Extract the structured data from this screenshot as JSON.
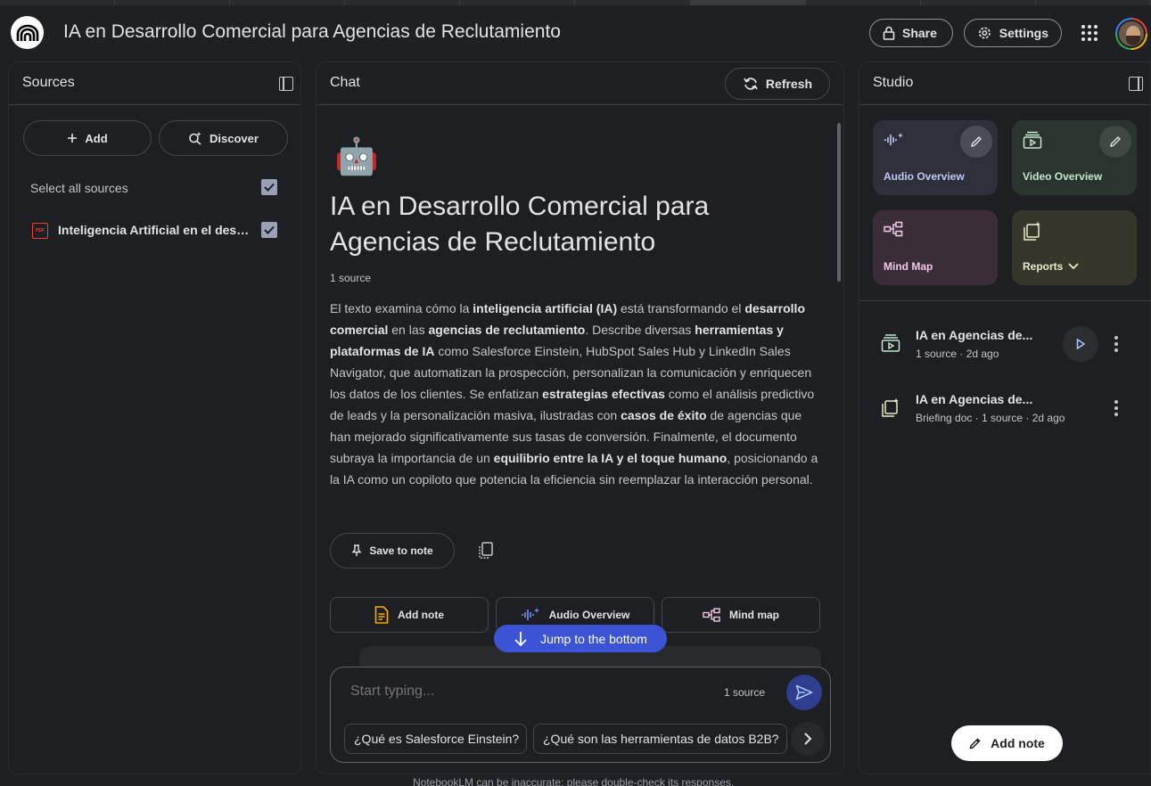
{
  "header": {
    "app_title": "IA en Desarrollo Comercial para Agencias de Reclutamiento",
    "share_label": "Share",
    "settings_label": "Settings"
  },
  "sources": {
    "title": "Sources",
    "add_label": "Add",
    "discover_label": "Discover",
    "select_all_label": "Select all sources",
    "items": [
      {
        "name": "Inteligencia Artificial en el desarrollo comercial de agencias de reclutamiento",
        "checked": true
      }
    ]
  },
  "chat": {
    "title": "Chat",
    "refresh_label": "Refresh",
    "emoji": "🤖",
    "doc_title": "IA en Desarrollo Comercial para Agencias de Reclutamiento",
    "source_count": "1 source",
    "summary_segments": [
      {
        "text": "El texto examina cómo la ",
        "bold": false
      },
      {
        "text": "inteligencia artificial (IA)",
        "bold": true
      },
      {
        "text": " está transformando el ",
        "bold": false
      },
      {
        "text": "desarrollo comercial",
        "bold": true
      },
      {
        "text": " en las ",
        "bold": false
      },
      {
        "text": "agencias de reclutamiento",
        "bold": true
      },
      {
        "text": ". Describe diversas ",
        "bold": false
      },
      {
        "text": "herramientas y plataformas de IA",
        "bold": true
      },
      {
        "text": " como Salesforce Einstein, HubSpot Sales Hub y LinkedIn Sales Navigator, que automatizan la prospección, personalizan la comunicación y enriquecen los datos de los clientes. Se enfatizan ",
        "bold": false
      },
      {
        "text": "estrategias efectivas",
        "bold": true
      },
      {
        "text": " como el análisis predictivo de leads y la personalización masiva, ilustradas con ",
        "bold": false
      },
      {
        "text": "casos de éxito",
        "bold": true
      },
      {
        "text": " de agencias que han mejorado significativamente sus tasas de conversión. Finalmente, el documento subraya la importancia de un ",
        "bold": false
      },
      {
        "text": "equilibrio entre la IA y el toque humano",
        "bold": true
      },
      {
        "text": ", posicionando a la IA como un copiloto que potencia la eficiencia sin reemplazar la interacción personal.",
        "bold": false
      }
    ],
    "save_to_note_label": "Save to note",
    "actions": {
      "add_note": "Add note",
      "audio_overview": "Audio Overview",
      "mind_map": "Mind map"
    },
    "jump_label": "Jump to the bottom",
    "composer": {
      "placeholder": "Start typing...",
      "source_count": "1 source"
    },
    "suggestions": [
      "¿Qué es Salesforce Einstein?",
      "¿Qué son las herramientas de datos B2B?"
    ]
  },
  "studio": {
    "title": "Studio",
    "tiles": {
      "audio": "Audio Overview",
      "video": "Video Overview",
      "mind": "Mind Map",
      "reports": "Reports"
    },
    "notes": [
      {
        "title": "IA en Agencias de...",
        "meta": "1 source · 2d ago"
      },
      {
        "title": "IA en Agencias de...",
        "meta": "Briefing doc · 1 source · 2d ago"
      }
    ],
    "add_note_label": "Add note"
  },
  "footer": {
    "disclaimer": "NotebookLM can be inaccurate; please double-check its responses."
  },
  "colors": {
    "background": "#1f2023",
    "accent_blue": "#3c53d6",
    "pdf_red": "#ea4335"
  }
}
